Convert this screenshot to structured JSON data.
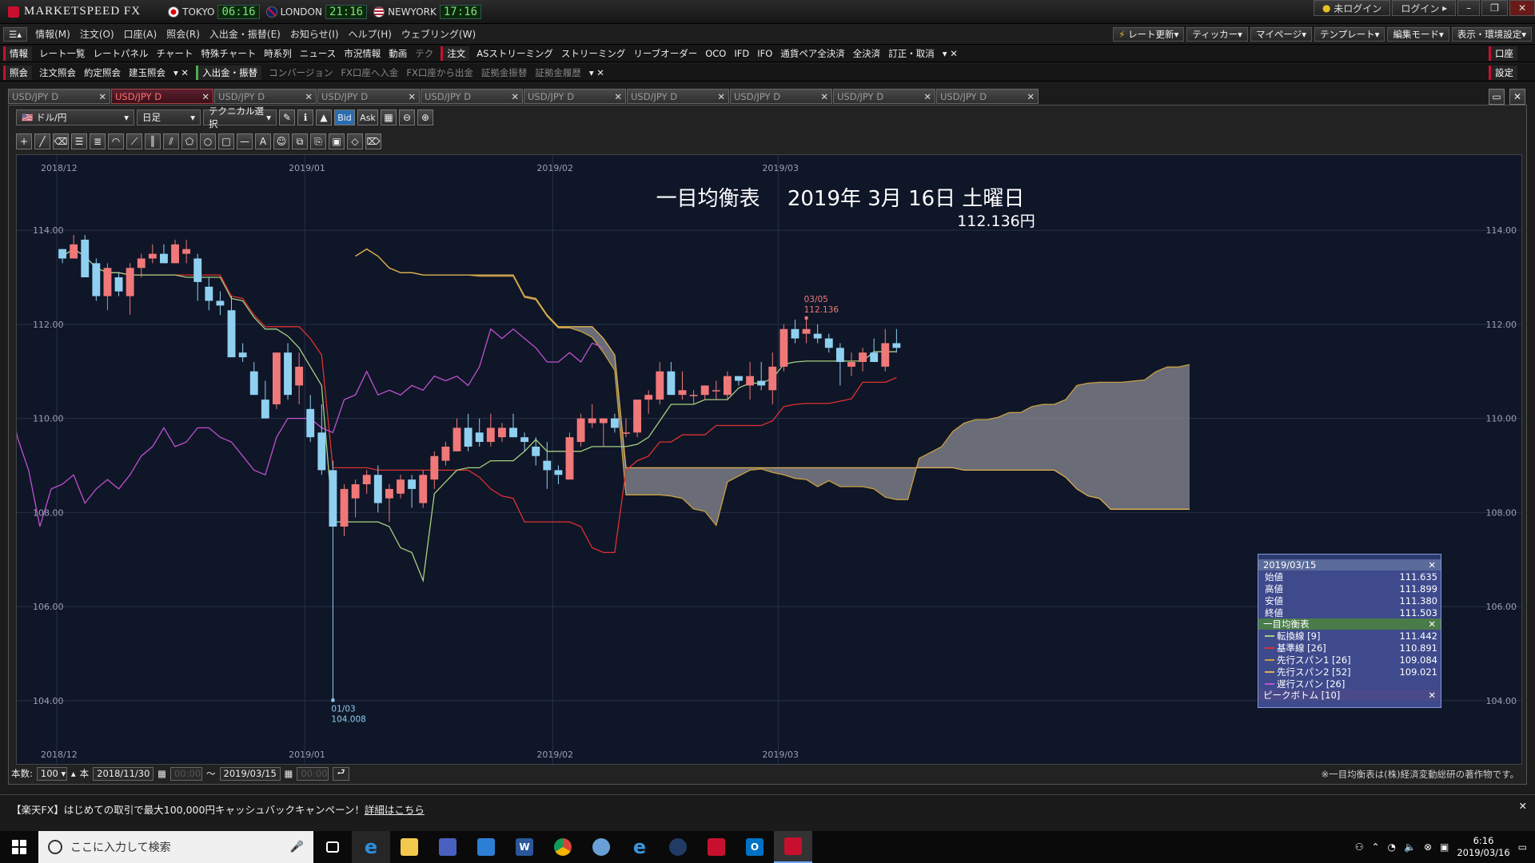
{
  "app": {
    "title": "MARKETSPEED FX"
  },
  "clocks": [
    {
      "city": "TOKYO",
      "time": "06:16"
    },
    {
      "city": "LONDON",
      "time": "21:16"
    },
    {
      "city": "NEWYORK",
      "time": "17:16"
    }
  ],
  "window": {
    "login_status": "未ログイン",
    "login": "ログイン"
  },
  "menu": {
    "items": [
      "情報(M)",
      "注文(O)",
      "口座(A)",
      "照会(R)",
      "入出金・振替(E)",
      "お知らせ(I)",
      "ヘルプ(H)",
      "ウェブリング(W)"
    ],
    "right": [
      "レート更新",
      "ティッカー",
      "マイページ",
      "テンプレート",
      "編集モード",
      "表示・環境設定"
    ]
  },
  "row2": {
    "section": "情報",
    "items": [
      "レート一覧",
      "レートパネル",
      "チャート",
      "特殊チャート",
      "時系列",
      "ニュース",
      "市況情報",
      "動画",
      "テク"
    ],
    "section2": "注文",
    "items2": [
      "ASストリーミング",
      "ストリーミング",
      "リーブオーダー",
      "OCO",
      "IFD",
      "IFO",
      "通貨ペア全決済",
      "全決済",
      "訂正・取消"
    ],
    "right": "口座"
  },
  "row3": {
    "section": "照会",
    "items": [
      "注文照会",
      "約定照会",
      "建玉照会"
    ],
    "section2": "入出金・振替",
    "items2": [
      "コンバージョン",
      "FX口座へ入金",
      "FX口座から出金",
      "証拠金振替",
      "証拠金履歴"
    ],
    "right": "設定"
  },
  "tabs": [
    "USD/JPY D",
    "USD/JPY D",
    "USD/JPY D",
    "USD/JPY D",
    "USD/JPY D",
    "USD/JPY D",
    "USD/JPY D",
    "USD/JPY D",
    "USD/JPY D",
    "USD/JPY D"
  ],
  "active_tab": 1,
  "chart_toolbar": {
    "pair": "ドル/円",
    "period": "日足",
    "technical": "テクニカル選択",
    "bid": "Bid",
    "ask": "Ask"
  },
  "chart_data": {
    "type": "candlestick",
    "title": "一目均衡表　 2019年 3月 16日 土曜日",
    "last_price": "112.136円",
    "y_ticks": [
      "114.00",
      "112.00",
      "110.00",
      "108.00",
      "106.00",
      "104.00"
    ],
    "x_ticks": [
      "2018/12",
      "2019/01",
      "2019/02",
      "2019/03"
    ],
    "ylim": [
      103.3,
      115.6
    ],
    "annot_high": {
      "date": "03/05",
      "value": "112.136"
    },
    "annot_low": {
      "date": "01/03",
      "value": "104.008"
    },
    "candles": [
      [
        113.6,
        113.6,
        113.3,
        113.4
      ],
      [
        113.4,
        113.9,
        113.5,
        113.7
      ],
      [
        113.8,
        113.9,
        113.0,
        113.0
      ],
      [
        113.3,
        113.4,
        112.5,
        112.6
      ],
      [
        112.6,
        113.3,
        112.3,
        113.2
      ],
      [
        113.0,
        113.1,
        112.6,
        112.7
      ],
      [
        112.6,
        113.3,
        112.2,
        113.2
      ],
      [
        113.2,
        113.5,
        113.0,
        113.4
      ],
      [
        113.4,
        113.7,
        113.3,
        113.5
      ],
      [
        113.5,
        113.7,
        113.3,
        113.3
      ],
      [
        113.3,
        113.8,
        113.3,
        113.7
      ],
      [
        113.5,
        113.8,
        113.3,
        113.6
      ],
      [
        113.4,
        113.5,
        112.5,
        112.9
      ],
      [
        112.8,
        113.0,
        112.3,
        112.5
      ],
      [
        112.5,
        112.7,
        112.2,
        112.4
      ],
      [
        112.3,
        112.6,
        111.3,
        111.3
      ],
      [
        111.4,
        111.6,
        111.2,
        111.3
      ],
      [
        111.0,
        111.2,
        110.5,
        110.5
      ],
      [
        110.4,
        110.8,
        110.0,
        110.0
      ],
      [
        110.3,
        111.4,
        110.2,
        111.4
      ],
      [
        111.4,
        111.6,
        110.4,
        110.5
      ],
      [
        110.7,
        111.4,
        110.3,
        111.1
      ],
      [
        110.2,
        110.5,
        109.5,
        109.6
      ],
      [
        109.7,
        110.3,
        108.8,
        108.9
      ],
      [
        108.9,
        109.1,
        104.0,
        107.7
      ],
      [
        107.7,
        108.6,
        107.5,
        108.5
      ],
      [
        108.3,
        108.7,
        107.9,
        108.6
      ],
      [
        108.6,
        108.9,
        108.4,
        108.8
      ],
      [
        108.8,
        109.0,
        108.0,
        108.2
      ],
      [
        108.3,
        108.6,
        107.8,
        108.5
      ],
      [
        108.4,
        108.8,
        108.3,
        108.7
      ],
      [
        108.7,
        108.8,
        108.1,
        108.5
      ],
      [
        108.2,
        108.9,
        108.1,
        108.8
      ],
      [
        108.7,
        109.3,
        108.5,
        109.2
      ],
      [
        109.1,
        109.5,
        109.0,
        109.4
      ],
      [
        109.3,
        110.0,
        109.3,
        109.8
      ],
      [
        109.8,
        110.1,
        109.3,
        109.4
      ],
      [
        109.7,
        110.0,
        109.4,
        109.5
      ],
      [
        109.5,
        110.1,
        109.4,
        109.8
      ],
      [
        109.6,
        109.9,
        109.5,
        109.8
      ],
      [
        109.8,
        110.1,
        109.6,
        109.6
      ],
      [
        109.6,
        109.7,
        109.3,
        109.5
      ],
      [
        109.4,
        109.6,
        109.0,
        109.2
      ],
      [
        109.1,
        109.5,
        108.5,
        108.9
      ],
      [
        108.9,
        109.0,
        108.6,
        108.8
      ],
      [
        108.7,
        109.7,
        108.7,
        109.6
      ],
      [
        109.5,
        110.1,
        109.4,
        110.0
      ],
      [
        109.9,
        110.3,
        109.8,
        110.0
      ],
      [
        109.9,
        110.0,
        109.4,
        110.0
      ],
      [
        110.0,
        110.1,
        109.7,
        109.8
      ],
      [
        109.7,
        110.0,
        109.6,
        109.7
      ],
      [
        109.7,
        110.4,
        109.6,
        110.4
      ],
      [
        110.4,
        110.6,
        110.1,
        110.5
      ],
      [
        110.4,
        111.2,
        110.3,
        111.0
      ],
      [
        111.0,
        111.2,
        110.5,
        110.5
      ],
      [
        110.5,
        111.0,
        110.4,
        110.6
      ],
      [
        110.5,
        110.6,
        110.3,
        110.5
      ],
      [
        110.5,
        110.7,
        110.4,
        110.7
      ],
      [
        110.6,
        110.8,
        110.4,
        110.6
      ],
      [
        110.5,
        111.0,
        110.4,
        110.9
      ],
      [
        110.9,
        110.9,
        110.7,
        110.8
      ],
      [
        110.7,
        111.2,
        110.4,
        110.9
      ],
      [
        110.8,
        111.2,
        110.6,
        110.7
      ],
      [
        110.6,
        111.4,
        110.3,
        111.1
      ],
      [
        111.1,
        112.0,
        111.0,
        111.9
      ],
      [
        111.9,
        112.1,
        111.6,
        111.7
      ],
      [
        111.8,
        112.136,
        111.6,
        111.9
      ],
      [
        111.8,
        112.0,
        111.6,
        111.7
      ],
      [
        111.7,
        111.8,
        111.4,
        111.5
      ],
      [
        111.5,
        111.6,
        110.7,
        111.2
      ],
      [
        111.1,
        111.4,
        110.9,
        111.2
      ],
      [
        111.2,
        111.5,
        111.0,
        111.4
      ],
      [
        111.4,
        111.7,
        111.2,
        111.2
      ],
      [
        111.1,
        111.9,
        111.0,
        111.6
      ],
      [
        111.6,
        111.9,
        111.4,
        111.5
      ]
    ],
    "conversion_line": {
      "name": "転換線 [9]",
      "color": "#a8d080"
    },
    "base_line": {
      "name": "基準線 [26]",
      "color": "#e03030"
    },
    "span_a": {
      "name": "先行スパン1 [26]",
      "color": "#c8a040"
    },
    "span_b": {
      "name": "先行スパン2 [52]",
      "color": "#e0b050"
    },
    "lagging_span": {
      "name": "遅行スパン [26]",
      "color": "#c050d0"
    }
  },
  "infobox": {
    "date": "2019/03/15",
    "rows": [
      {
        "label": "始値",
        "value": "111.635"
      },
      {
        "label": "高値",
        "value": "111.899"
      },
      {
        "label": "安値",
        "value": "111.380"
      },
      {
        "label": "終値",
        "value": "111.503"
      }
    ],
    "section": "一目均衡表",
    "indicators": [
      {
        "label": "転換線 [9]",
        "value": "111.442",
        "color": "#a8d080"
      },
      {
        "label": "基準線 [26]",
        "value": "110.891",
        "color": "#e03030"
      },
      {
        "label": "先行スパン1 [26]",
        "value": "109.084",
        "color": "#c8a040"
      },
      {
        "label": "先行スパン2 [52]",
        "value": "109.021",
        "color": "#e0b050"
      },
      {
        "label": "遅行スパン [26]",
        "value": "",
        "color": "#c050d0"
      }
    ],
    "footer": "ピークボトム [10]"
  },
  "footbar": {
    "count_label": "本数:",
    "count": "100",
    "unit": "本",
    "from": "2018/11/30",
    "to": "2019/03/15",
    "tilde": "～",
    "from_time": "00:00",
    "to_time": "00:00"
  },
  "copyright": "※一目均衡表は(株)経済変動総研の著作物です。",
  "notice": {
    "text": "【楽天FX】はじめての取引で最大100,000円キャッシュバックキャンペーン！",
    "link": "詳細はこちら"
  },
  "taskbar": {
    "search_placeholder": "ここに入力して検索",
    "time": "6:16",
    "date": "2019/03/16"
  }
}
